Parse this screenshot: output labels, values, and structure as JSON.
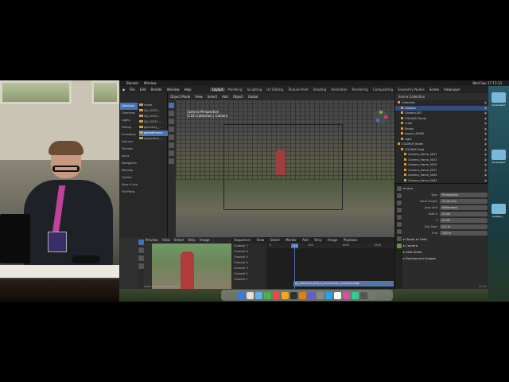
{
  "mac_menubar": {
    "apple": "",
    "app": "Blender",
    "window_menu": "Window",
    "clock": "Wed Sep 17 17:13"
  },
  "blender": {
    "title": "Untitled – Blender 4.x",
    "menus": [
      "File",
      "Edit",
      "Render",
      "Window",
      "Help"
    ],
    "workspaces": [
      "Layout",
      "Modeling",
      "Sculpting",
      "UV Editing",
      "Texture Paint",
      "Shading",
      "Animation",
      "Rendering",
      "Compositing",
      "Geometry Nodes"
    ],
    "active_workspace": "Layout",
    "scene": "Scene",
    "view_layer": "ViewLayer",
    "version": "4.5.0"
  },
  "file_browser": {
    "categories": [
      "Selection",
      "Overview",
      "Lights",
      "Editing",
      "Animation",
      "Add-ons",
      "Themes",
      "Input",
      "Navigation",
      "Keymap",
      "System",
      "Save & Load",
      "File Paths"
    ],
    "selected_category": "Selection",
    "files": [
      "Home",
      "DJI_20231...",
      "DJI_20231...",
      "DJI_20231...",
      "geometry_...",
      "georeference...",
      "skyroptical_..."
    ]
  },
  "viewport": {
    "mode": "Object Mode",
    "menus": [
      "View",
      "Select",
      "Add",
      "Object"
    ],
    "transform": "Global",
    "camera_label": "Camera Perspective",
    "camera_sub": "(110) Collection | Camera"
  },
  "outliner": {
    "header": "Scene Collection",
    "rows": [
      {
        "label": "Collection",
        "sel": false
      },
      {
        "label": "Camera",
        "sel": true
      },
      {
        "label": "Camera.001",
        "sel": false
      },
      {
        "label": "COLMAP_Points",
        "sel": false
      },
      {
        "label": "Cube",
        "sel": false
      },
      {
        "label": "Empty",
        "sel": false
      },
      {
        "label": "export_45480",
        "sel": false
      },
      {
        "label": "Light",
        "sel": false
      },
      {
        "label": "COLMAP_Model",
        "sel": false
      },
      {
        "label": "COLMAP_Root",
        "sel": false
      },
      {
        "label": "Camera_frame_0001",
        "sel": false
      },
      {
        "label": "Camera_frame_0013",
        "sel": false
      },
      {
        "label": "Camera_frame_0025",
        "sel": false
      },
      {
        "label": "Camera_frame_0037",
        "sel": false
      },
      {
        "label": "Camera_frame_0049",
        "sel": false
      },
      {
        "label": "Camera_frame_0061",
        "sel": false
      },
      {
        "label": "Camera_frame_0073",
        "sel": false
      }
    ]
  },
  "properties": {
    "section": "Lens",
    "type": {
      "label": "Type",
      "value": "Perspective"
    },
    "focal_length": {
      "label": "Focal Length",
      "value": "23.04 mm"
    },
    "lens_unit": {
      "label": "Lens Unit",
      "value": "Millimeters"
    },
    "shift_x": {
      "label": "Shift X",
      "value": "0.000"
    },
    "shift_y": {
      "label": "Y",
      "value": "0.000"
    },
    "clip_start": {
      "label": "Clip Start",
      "value": "0.1 m"
    },
    "clip_end": {
      "label": "End",
      "value": "100 m"
    },
    "collapsed": [
      "Depth of Field",
      "Camera",
      "Safe Areas",
      "Background Images"
    ]
  },
  "preview": {
    "menus": [
      "Preview",
      "View",
      "Select",
      "Strip",
      "Image"
    ]
  },
  "sequencer": {
    "menus": [
      "Sequencer",
      "View",
      "Select",
      "Marker",
      "Add",
      "Strip",
      "Image"
    ],
    "playback": "Playback",
    "current_frame": "110",
    "ruler": [
      "0",
      "100",
      "1000",
      "1500"
    ],
    "channels": [
      "Channel 7",
      "Channel 6",
      "Channel 5",
      "Channel 4",
      "Channel 3",
      "Channel 2",
      "Channel 1"
    ],
    "strip_label": "DJI_20250915_0010_D_preview.mp4 | 1/ws/videos/DJI..."
  },
  "status_bar": "Select   Pan View   Context Menu",
  "desktop": {
    "icons": [
      "Screenshot",
      "Screenshot",
      "Untitled_..."
    ]
  }
}
